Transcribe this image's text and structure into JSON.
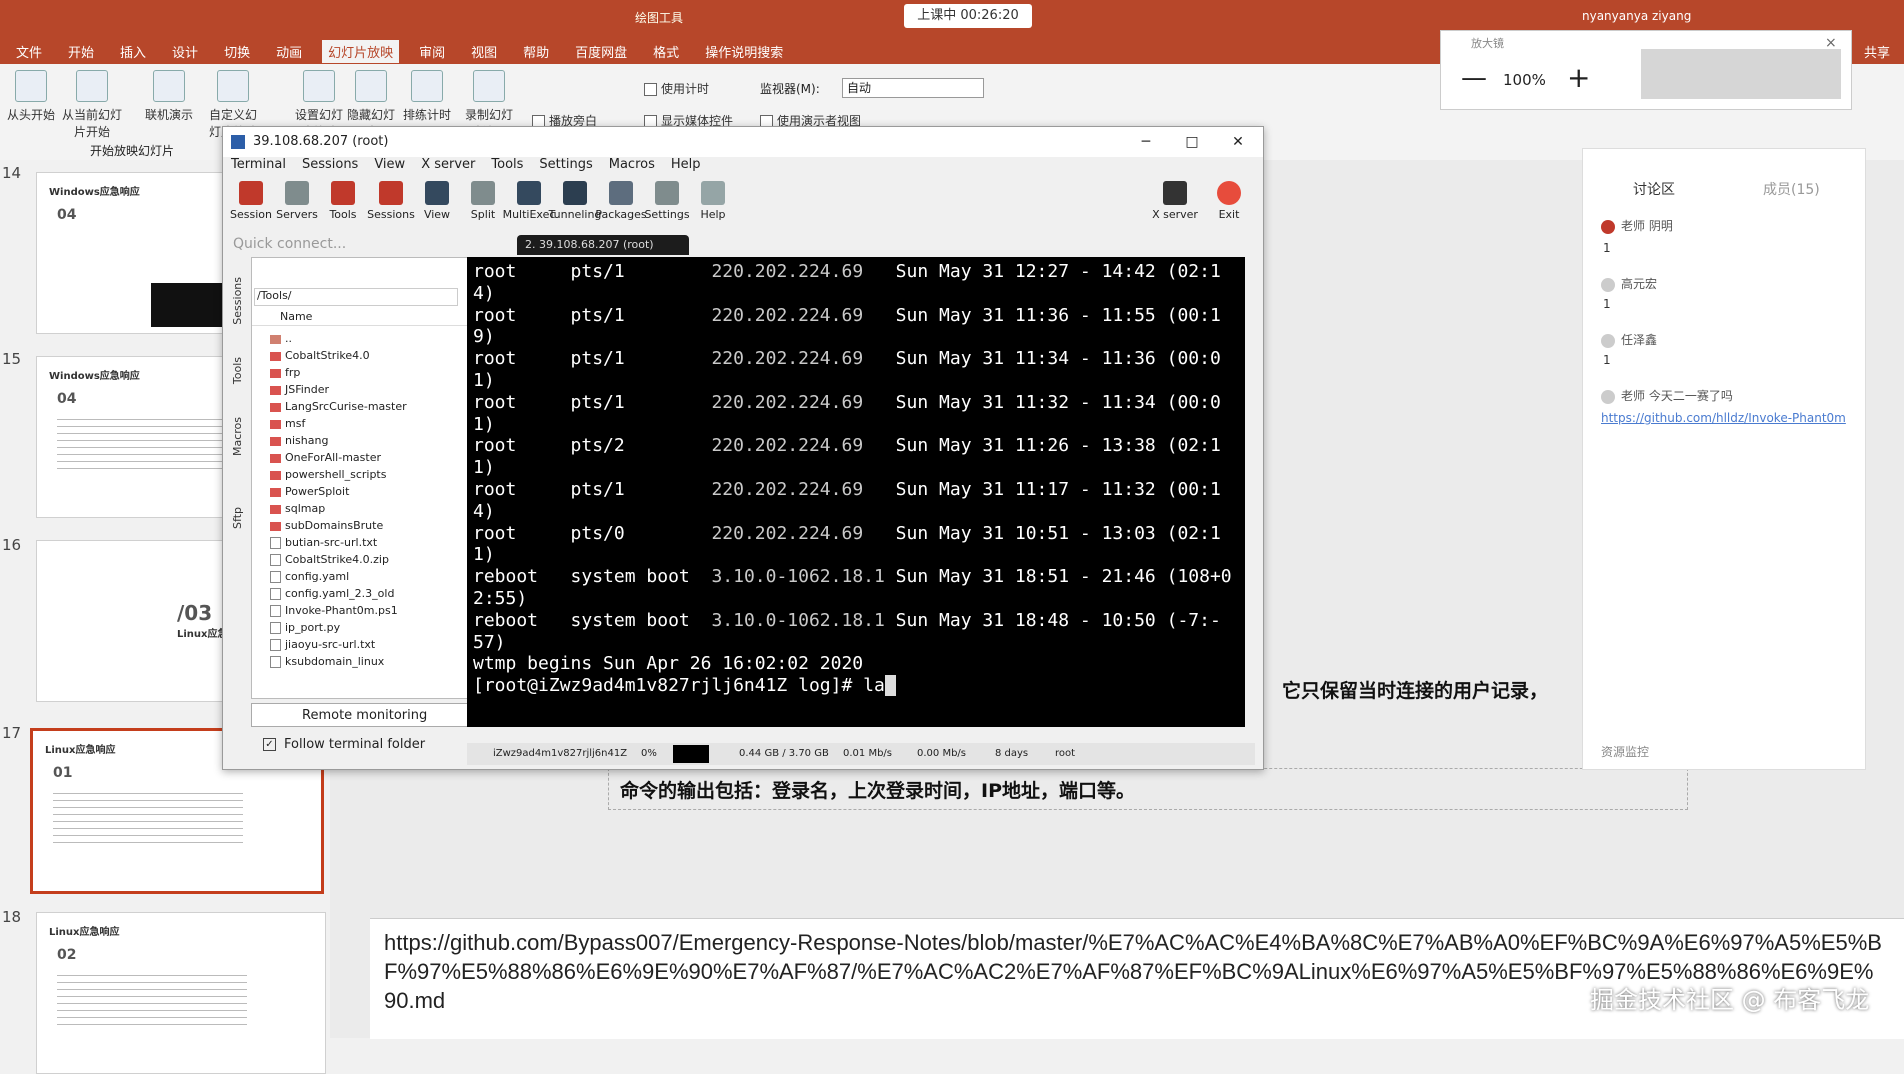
{
  "ppt": {
    "tabs": [
      "文件",
      "开始",
      "插入",
      "设计",
      "切换",
      "动画",
      "幻灯片放映",
      "审阅",
      "视图",
      "帮助",
      "百度网盘",
      "格式",
      "操作说明搜索"
    ],
    "active_tab": "幻灯片放映",
    "drawing_tools_label": "绘图工具",
    "user_name": "nyanyanya ziyang",
    "share_label": "共享",
    "ribbon": {
      "from_start": "从头开始",
      "from_current": "从当前幻灯片开始",
      "online_present": "联机演示",
      "custom_show": "自定义幻灯片放映",
      "group_label": "开始放映幻灯片",
      "setup": "设置幻灯片放映",
      "hide": "隐藏幻灯片",
      "rehearse": "排练计时",
      "record": "录制幻灯片演示",
      "use_timings": "使用计时",
      "play_narration": "播放旁白",
      "show_media": "显示媒体控件",
      "monitor_label": "监视器(M):",
      "monitor_value": "自动",
      "presenter_view": "使用演示者视图"
    }
  },
  "recording": {
    "status": "上课中 00:26:20"
  },
  "zoom": {
    "label": "放大镜",
    "value": "100%",
    "minus": "—",
    "plus": "+",
    "close": "×"
  },
  "slides": [
    {
      "num": "14",
      "title": "Windows应急响应",
      "big": "04"
    },
    {
      "num": "15",
      "title": "Windows应急响应",
      "big": "04"
    },
    {
      "num": "16",
      "title": "Linux应急响应",
      "big": "/03"
    },
    {
      "num": "17",
      "title": "Linux应急响应",
      "big": "01"
    },
    {
      "num": "18",
      "title": "Linux应急响应",
      "big": "02"
    }
  ],
  "slide_content": {
    "text_right": "它只保留当时连接的用户记录，",
    "text_bottom": "命令的输出包括：登录名，上次登录时间，IP地址，端口等。"
  },
  "notes": {
    "text": "https://github.com/Bypass007/Emergency-Response-Notes/blob/master/%E7%AC%AC%E4%BA%8C%E7%AB%A0%EF%BC%9A%E6%97%A5%E5%BF%97%E5%88%86%E6%9E%90%E7%AF%87/%E7%AC%AC2%E7%AF%87%EF%BC%9ALinux%E6%97%A5%E5%BF%97%E5%88%86%E6%9E%90.md"
  },
  "watermark": "掘金技术社区 @ 布客飞龙",
  "chat": {
    "tab_discussion": "讨论区",
    "tab_members": "成员(15)",
    "users": [
      {
        "name": "老师 阴明",
        "count": "1"
      },
      {
        "name": "高元宏",
        "count": "1"
      },
      {
        "name": "任泽鑫",
        "count": "1"
      }
    ],
    "last_msg_user": "老师 今天二一赛了吗",
    "link": "https://github.com/hlldz/Invoke-Phant0m",
    "bottom_label": "资源监控"
  },
  "moba": {
    "title": "39.108.68.207 (root)",
    "menu": [
      "Terminal",
      "Sessions",
      "View",
      "X server",
      "Tools",
      "Settings",
      "Macros",
      "Help"
    ],
    "toolbar": [
      {
        "label": "Session",
        "icon": "session-icon",
        "color": "#c0392b"
      },
      {
        "label": "Servers",
        "icon": "servers-icon",
        "color": "#7f8c8d"
      },
      {
        "label": "Tools",
        "icon": "tools-icon",
        "color": "#c0392b"
      },
      {
        "label": "Sessions",
        "icon": "sessions-icon",
        "color": "#c0392b"
      },
      {
        "label": "View",
        "icon": "view-icon",
        "color": "#34495e"
      },
      {
        "label": "Split",
        "icon": "split-icon",
        "color": "#7f8c8d"
      },
      {
        "label": "MultiExec",
        "icon": "multiexec-icon",
        "color": "#34495e"
      },
      {
        "label": "Tunneling",
        "icon": "tunneling-icon",
        "color": "#2c3e50"
      },
      {
        "label": "Packages",
        "icon": "packages-icon",
        "color": "#5d6d7e"
      },
      {
        "label": "Settings",
        "icon": "settings-icon",
        "color": "#7f8c8d"
      },
      {
        "label": "Help",
        "icon": "help-icon",
        "color": "#95a5a6"
      }
    ],
    "xserver_label": "X server",
    "exit_label": "Exit",
    "quick_connect_placeholder": "Quick connect...",
    "terminal_tab": "2. 39.108.68.207 (root)",
    "side_tabs": [
      "Sessions",
      "Tools",
      "Macros",
      "Sftp"
    ],
    "file_path": "/Tools/",
    "name_header": "Name",
    "files": [
      {
        "name": "..",
        "type": "up"
      },
      {
        "name": "CobaltStrike4.0",
        "type": "folder"
      },
      {
        "name": "frp",
        "type": "folder"
      },
      {
        "name": "JSFinder",
        "type": "folder"
      },
      {
        "name": "LangSrcCurise-master",
        "type": "folder"
      },
      {
        "name": "msf",
        "type": "folder"
      },
      {
        "name": "nishang",
        "type": "folder"
      },
      {
        "name": "OneForAll-master",
        "type": "folder"
      },
      {
        "name": "powershell_scripts",
        "type": "folder"
      },
      {
        "name": "PowerSploit",
        "type": "folder"
      },
      {
        "name": "sqlmap",
        "type": "folder"
      },
      {
        "name": "subDomainsBrute",
        "type": "folder"
      },
      {
        "name": "butian-src-url.txt",
        "type": "file"
      },
      {
        "name": "CobaltStrike4.0.zip",
        "type": "file"
      },
      {
        "name": "config.yaml",
        "type": "file"
      },
      {
        "name": "config.yaml_2.3_old",
        "type": "file"
      },
      {
        "name": "Invoke-Phant0m.ps1",
        "type": "file"
      },
      {
        "name": "ip_port.py",
        "type": "file"
      },
      {
        "name": "jiaoyu-src-url.txt",
        "type": "file"
      },
      {
        "name": "ksubdomain_linux",
        "type": "file"
      }
    ],
    "remote_monitoring": "Remote monitoring",
    "follow_folder": "Follow terminal folder",
    "terminal": [
      {
        "user": "root",
        "tty": "pts/1",
        "host": "220.202.224.69",
        "time": "Sun May 31 12:27 - 14:42",
        "dur": "(02:1",
        "wrap": "4)"
      },
      {
        "user": "root",
        "tty": "pts/1",
        "host": "220.202.224.69",
        "time": "Sun May 31 11:36 - 11:55",
        "dur": "(00:1",
        "wrap": "9)"
      },
      {
        "user": "root",
        "tty": "pts/1",
        "host": "220.202.224.69",
        "time": "Sun May 31 11:34 - 11:36",
        "dur": "(00:0",
        "wrap": "1)"
      },
      {
        "user": "root",
        "tty": "pts/1",
        "host": "220.202.224.69",
        "time": "Sun May 31 11:32 - 11:34",
        "dur": "(00:0",
        "wrap": "1)"
      },
      {
        "user": "root",
        "tty": "pts/2",
        "host": "220.202.224.69",
        "time": "Sun May 31 11:26 - 13:38",
        "dur": "(02:1",
        "wrap": "1)"
      },
      {
        "user": "root",
        "tty": "pts/1",
        "host": "220.202.224.69",
        "time": "Sun May 31 11:17 - 11:32",
        "dur": "(00:1",
        "wrap": "4)"
      },
      {
        "user": "root",
        "tty": "pts/0",
        "host": "220.202.224.69",
        "time": "Sun May 31 10:51 - 13:03",
        "dur": "(02:1",
        "wrap": "1)"
      },
      {
        "user": "reboot",
        "tty": "system boot",
        "host": "3.10.0-1062.18.1",
        "time": "Sun May 31 18:51 - 21:46",
        "dur": "(108+0",
        "wrap": "2:55)"
      },
      {
        "user": "reboot",
        "tty": "system boot",
        "host": "3.10.0-1062.18.1",
        "time": "Sun May 31 18:48 - 10:50",
        "dur": "(-7:-",
        "wrap": "57)"
      }
    ],
    "wtmp_line": "wtmp begins Sun Apr 26 16:02:02 2020",
    "prompt": "[root@iZwz9ad4m1v827rjlj6n41Z log]# ",
    "typed": "la",
    "status": {
      "host": "iZwz9ad4m1v827rjlj6n41Z",
      "cpu": "0%",
      "mem": "0.44 GB / 3.70 GB",
      "up": "0.01 Mb/s",
      "down": "0.00 Mb/s",
      "uptime": "8 days",
      "user": "root"
    }
  }
}
